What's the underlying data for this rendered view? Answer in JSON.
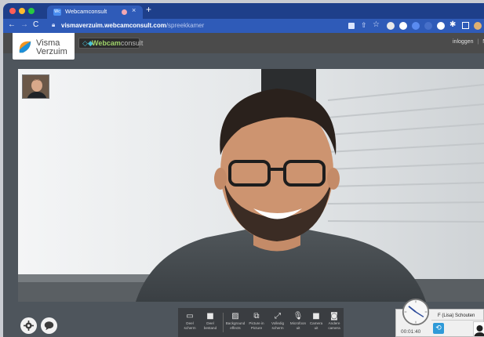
{
  "browser": {
    "tab_title": "Webcamconsult",
    "tab_favicon": "Wc",
    "url_host": "vismaverzuim.webcamconsult.com",
    "url_path": "/spreekkamer"
  },
  "header": {
    "logo_line1": "Visma",
    "logo_line2": "Verzuim",
    "wc_prefix": "Webcam",
    "wc_suffix": "consult",
    "login_label": "inloggen",
    "trailing_label": "N"
  },
  "toolbar": {
    "items": [
      {
        "label1": "Deel",
        "label2": "scherm",
        "icon": "screen-share-icon"
      },
      {
        "label1": "Deel",
        "label2": "bestand",
        "icon": "folder-icon"
      },
      {
        "label1": "Background",
        "label2": "effects",
        "icon": "image-icon"
      },
      {
        "label1": "Picture in",
        "label2": "Picture",
        "icon": "picture-in-picture-icon"
      },
      {
        "label1": "Volledig",
        "label2": "scherm",
        "icon": "fullscreen-icon"
      },
      {
        "label1": "Microfoon",
        "label2": "uit",
        "icon": "microphone-icon"
      },
      {
        "label1": "Camera",
        "label2": "uit",
        "icon": "camera-icon"
      },
      {
        "label1": "Andere",
        "label2": "camera",
        "icon": "switch-camera-icon"
      }
    ]
  },
  "participant": {
    "name": "F (Lisa) Schouten",
    "timer": "00:01:40"
  },
  "colors": {
    "tabstrip": "#1e3f8a",
    "addressbar": "#2f5bb8",
    "site_header": "#4b4b4b",
    "toolbar": "#3a3d41",
    "accent_blue": "#2f9ad8"
  }
}
